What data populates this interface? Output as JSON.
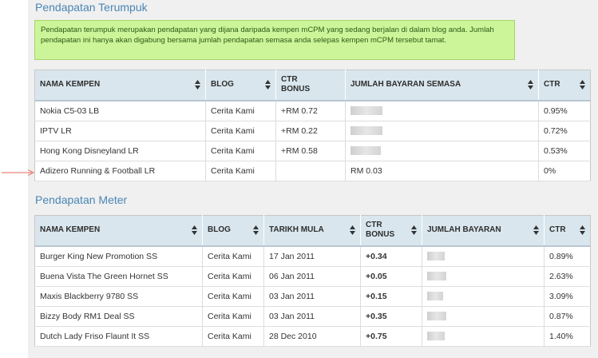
{
  "section1": {
    "title": "Pendapatan Terumpuk",
    "note": "Pendapatan terumpuk merupakan pendapatan yang dijana daripada kempen mCPM yang sedang berjalan di dalam blog anda. Jumlah pendapatan ini hanya akan digabung bersama jumlah pendapatan semasa anda selepas kempen mCPM tersebut tamat.",
    "headers": {
      "nama_kempen": "NAMA KEMPEN",
      "blog": "BLOG",
      "ctr_bonus_1": "CTR",
      "ctr_bonus_2": "BONUS",
      "jumlah": "JUMLAH BAYARAN SEMASA",
      "ctr": "CTR"
    },
    "rows": [
      {
        "nama": "Nokia C5-03 LB",
        "blog": "Cerita Kami",
        "bonus": "+RM 0.72",
        "jumlah": "",
        "ctr": "0.95%"
      },
      {
        "nama": "IPTV LR",
        "blog": "Cerita Kami",
        "bonus": "+RM 0.22",
        "jumlah": "",
        "ctr": "0.72%"
      },
      {
        "nama": "Hong Kong Disneyland LR",
        "blog": "Cerita Kami",
        "bonus": "+RM 0.58",
        "jumlah": "",
        "ctr": "0.53%"
      },
      {
        "nama": "Adizero Running & Football LR",
        "blog": "Cerita Kami",
        "bonus": "",
        "jumlah": "RM 0.03",
        "ctr": "0%"
      }
    ]
  },
  "section2": {
    "title": "Pendapatan Meter",
    "headers": {
      "nama_kempen": "NAMA KEMPEN",
      "blog": "BLOG",
      "tarikh": "TARIKH MULA",
      "ctr_bonus_1": "CTR",
      "ctr_bonus_2": "BONUS",
      "jumlah": "JUMLAH BAYARAN",
      "ctr": "CTR"
    },
    "rows": [
      {
        "nama": "Burger King New Promotion SS",
        "blog": "Cerita Kami",
        "tarikh": "17 Jan 2011",
        "bonus": "+0.34",
        "ctr": "0.89%"
      },
      {
        "nama": "Buena Vista The Green Hornet SS",
        "blog": "Cerita Kami",
        "tarikh": "06 Jan 2011",
        "bonus": "+0.05",
        "ctr": "2.63%"
      },
      {
        "nama": "Maxis Blackberry 9780 SS",
        "blog": "Cerita Kami",
        "tarikh": "03 Jan 2011",
        "bonus": "+0.15",
        "ctr": "3.09%"
      },
      {
        "nama": "Bizzy Body RM1 Deal SS",
        "blog": "Cerita Kami",
        "tarikh": "03 Jan 2011",
        "bonus": "+0.35",
        "ctr": "0.87%"
      },
      {
        "nama": "Dutch Lady Friso Flaunt It SS",
        "blog": "Cerita Kami",
        "tarikh": "28 Dec 2010",
        "bonus": "+0.75",
        "ctr": "1.40%"
      }
    ]
  },
  "colors": {
    "title": "#4a86b4",
    "note_bg": "#ccf59a",
    "header_bg": "#d9e6ed",
    "bonus_green": "#1f7a1f",
    "arrow": "#e8837a"
  },
  "icons": {
    "sort": "sort-arrows-icon",
    "pointer": "pointer-arrow-icon"
  }
}
